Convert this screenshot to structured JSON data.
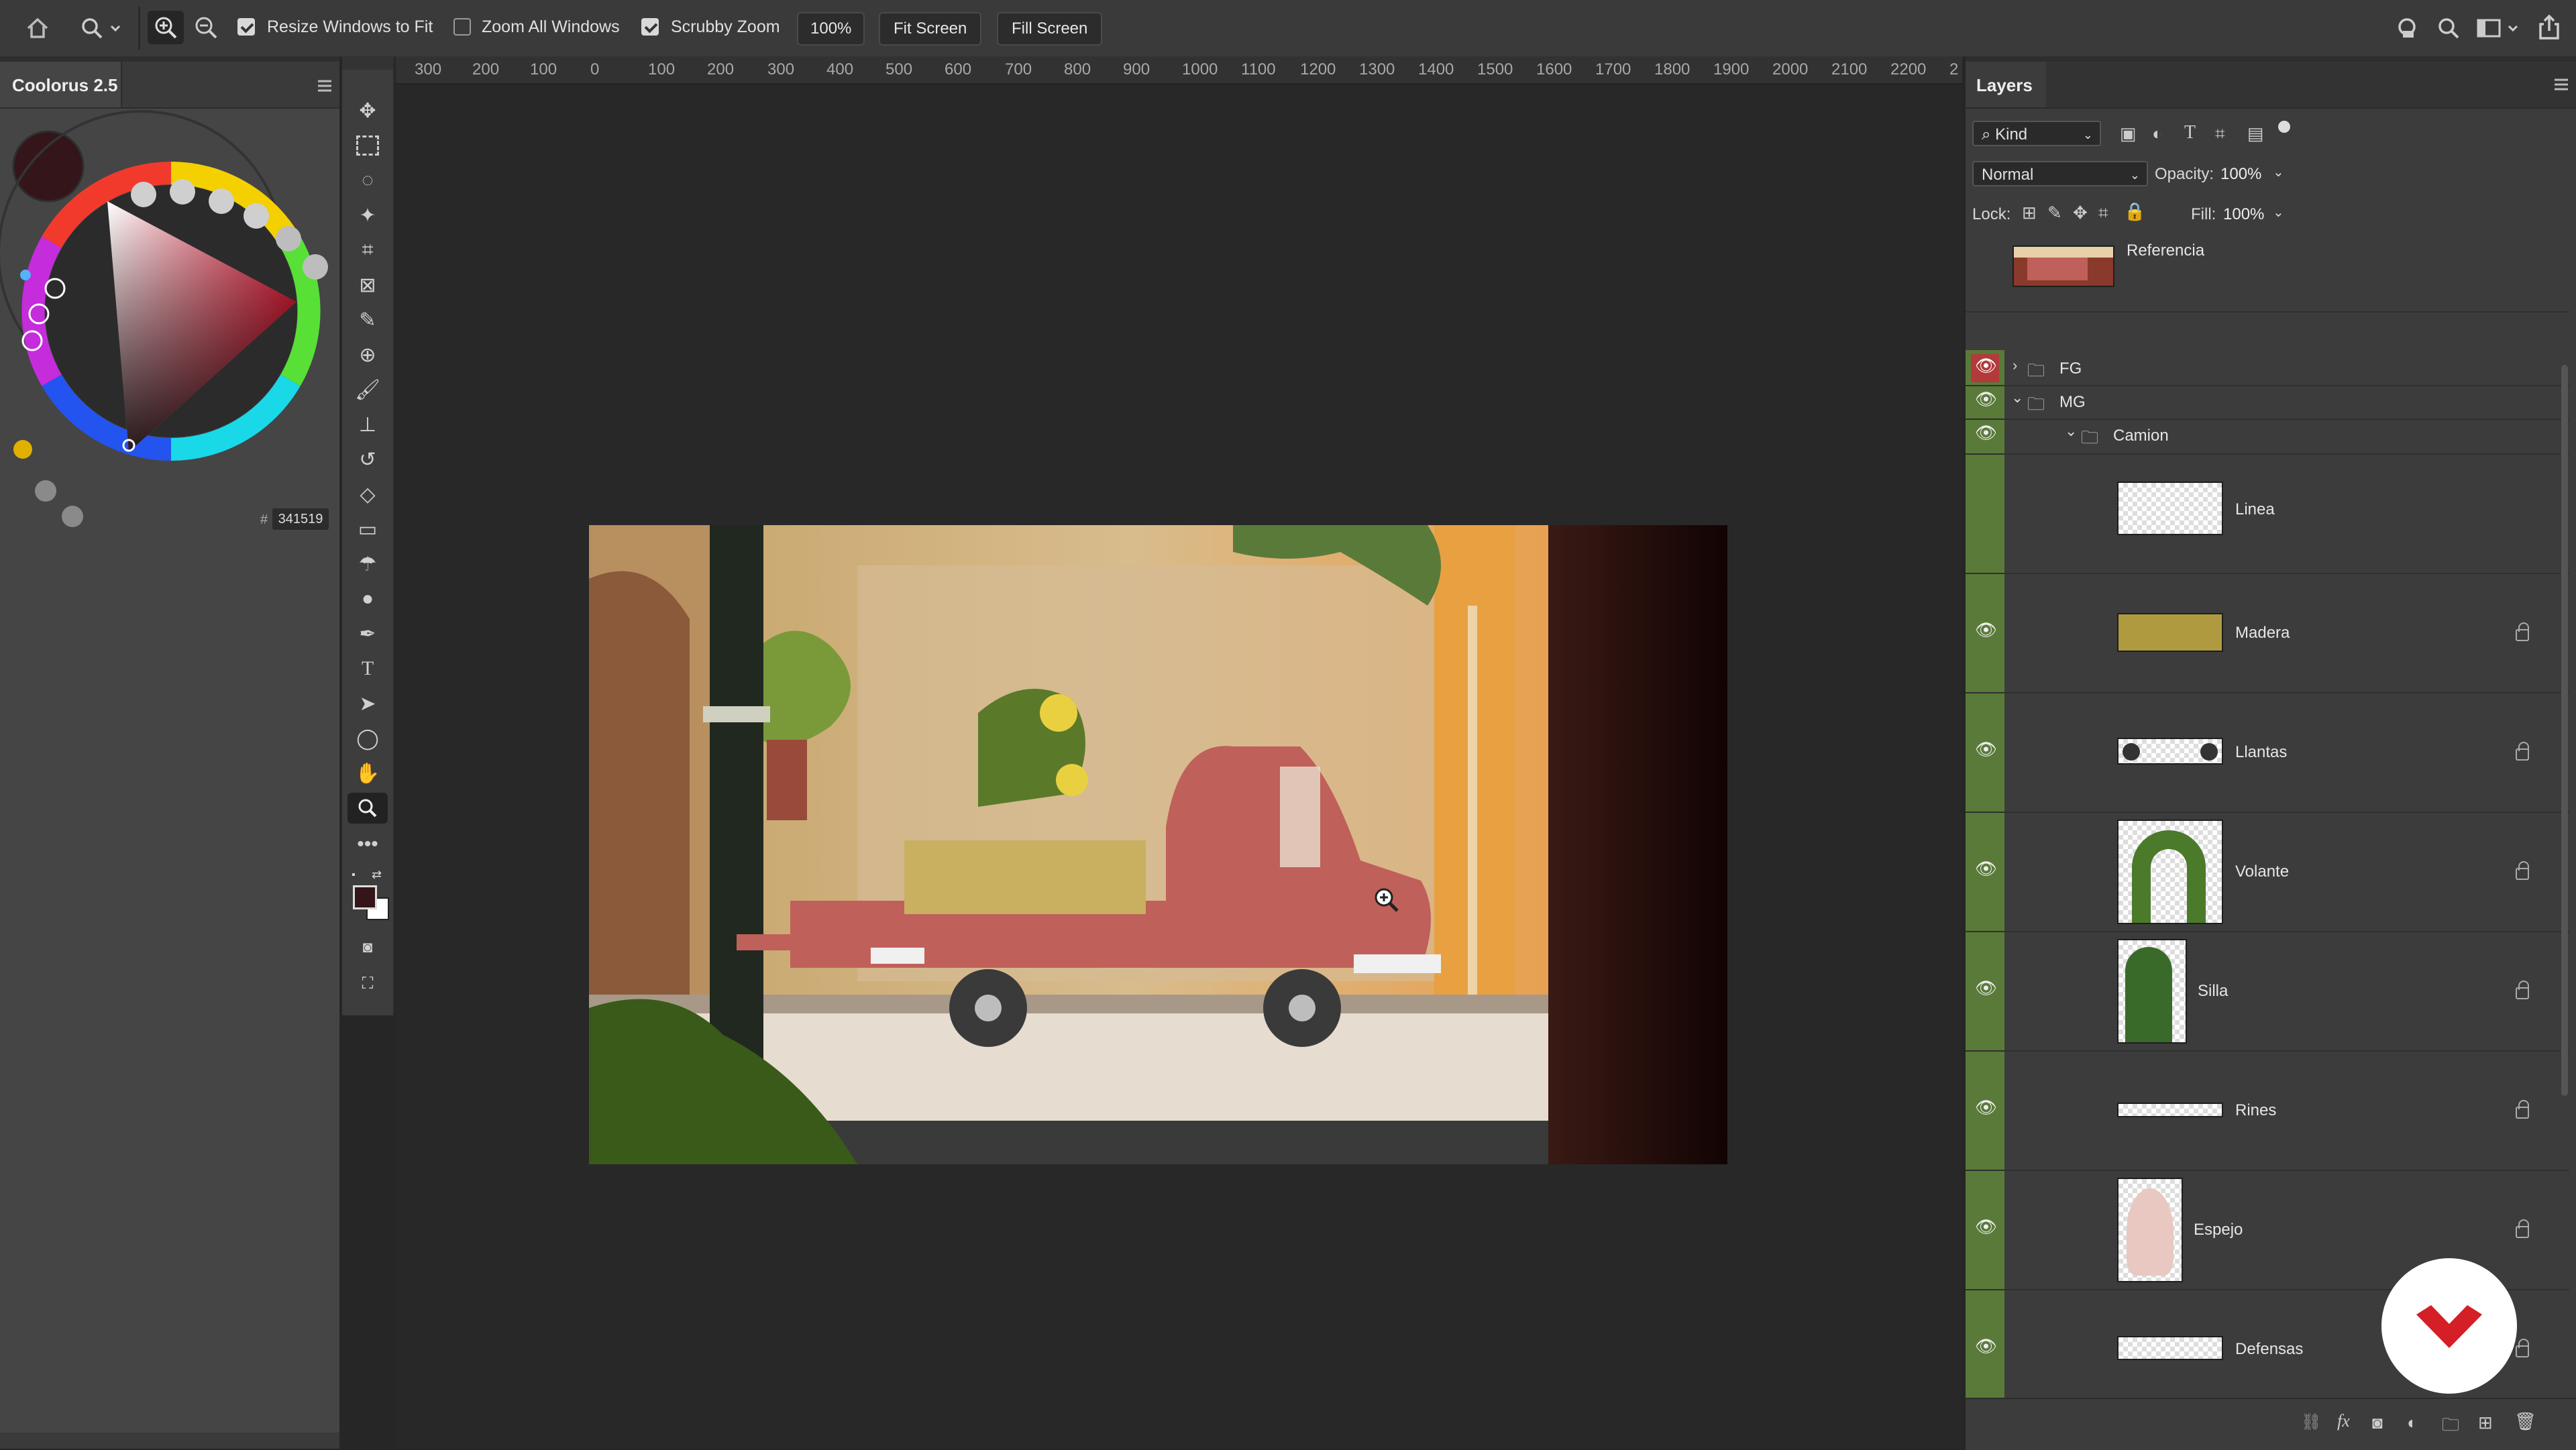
{
  "options_bar": {
    "resize_windows_label": "Resize Windows to Fit",
    "zoom_all_windows_label": "Zoom All Windows",
    "scrubby_zoom_label": "Scrubby Zoom",
    "zoom_value": "100%",
    "fit_screen_label": "Fit Screen",
    "fill_screen_label": "Fill Screen",
    "resize_windows_checked": true,
    "zoom_all_windows_checked": false,
    "scrubby_zoom_checked": true
  },
  "colour_panel": {
    "title": "Coolorus 2.5",
    "hex_prefix": "#",
    "hex_value": "341519",
    "current_color": "#341519"
  },
  "ruler": {
    "ticks": [
      "300",
      "200",
      "100",
      "0",
      "100",
      "200",
      "300",
      "400",
      "500",
      "600",
      "700",
      "800",
      "900",
      "1000",
      "1100",
      "1200",
      "1300",
      "1400",
      "1500",
      "1600",
      "1700",
      "1800",
      "1900",
      "2000",
      "2100",
      "2200",
      "2"
    ]
  },
  "layers_panel": {
    "title": "Layers",
    "filter_kind": "Kind",
    "blend_mode": "Normal",
    "opacity_label": "Opacity:",
    "opacity_value": "100%",
    "lock_label": "Lock:",
    "fill_label": "Fill:",
    "fill_value": "100%",
    "layers": [
      {
        "name": "Referencia",
        "visible": false
      },
      {
        "name": "FG",
        "visible": true
      },
      {
        "name": "MG",
        "visible": true
      },
      {
        "name": "Camion",
        "visible": true
      },
      {
        "name": "Linea",
        "visible": false
      },
      {
        "name": "Madera",
        "visible": true
      },
      {
        "name": "Llantas",
        "visible": true
      },
      {
        "name": "Volante",
        "visible": true
      },
      {
        "name": "Silla",
        "visible": true
      },
      {
        "name": "Rines",
        "visible": true
      },
      {
        "name": "Espejo",
        "visible": true
      },
      {
        "name": "Defensas",
        "visible": true
      }
    ]
  },
  "colors": {
    "group_strip": "#5a7a3a",
    "fg_eye_highlight": "#b23a3a",
    "logo_red": "#d41f26"
  }
}
